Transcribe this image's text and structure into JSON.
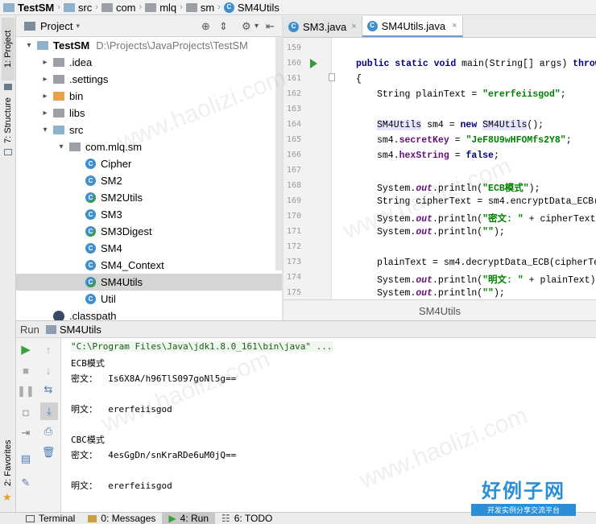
{
  "breadcrumbs": [
    "TestSM",
    "src",
    "com",
    "mlq",
    "sm",
    "SM4Utils"
  ],
  "sidebar": {
    "project_tab": "1: Project",
    "structure_tab": "7: Structure",
    "favorites_tab": "2: Favorites"
  },
  "project_panel": {
    "title": "Project",
    "tree": [
      {
        "label": "TestSM",
        "path": "D:\\Projects\\JavaProjects\\TestSM",
        "level": 0,
        "arrow": "▾",
        "icon": "folder-blue"
      },
      {
        "label": ".idea",
        "level": 1,
        "arrow": "▸",
        "icon": "folder-gray"
      },
      {
        "label": ".settings",
        "level": 1,
        "arrow": "▸",
        "icon": "folder-gray"
      },
      {
        "label": "bin",
        "level": 1,
        "arrow": "▸",
        "icon": "folder-orange"
      },
      {
        "label": "libs",
        "level": 1,
        "arrow": "▸",
        "icon": "folder-gray"
      },
      {
        "label": "src",
        "level": 1,
        "arrow": "▾",
        "icon": "folder-blue"
      },
      {
        "label": "com.mlq.sm",
        "level": 2,
        "arrow": "▾",
        "icon": "package"
      },
      {
        "label": "Cipher",
        "level": 3,
        "icon": "class"
      },
      {
        "label": "SM2",
        "level": 3,
        "icon": "class"
      },
      {
        "label": "SM2Utils",
        "level": 3,
        "icon": "class-main"
      },
      {
        "label": "SM3",
        "level": 3,
        "icon": "class"
      },
      {
        "label": "SM3Digest",
        "level": 3,
        "icon": "class-main"
      },
      {
        "label": "SM4",
        "level": 3,
        "icon": "class"
      },
      {
        "label": "SM4_Context",
        "level": 3,
        "icon": "class"
      },
      {
        "label": "SM4Utils",
        "level": 3,
        "icon": "class-main",
        "selected": true
      },
      {
        "label": "Util",
        "level": 3,
        "icon": "class"
      },
      {
        "label": ".classpath",
        "level": 1,
        "icon": "file"
      }
    ]
  },
  "editor": {
    "tabs": [
      {
        "label": "SM3.java",
        "active": false
      },
      {
        "label": "SM4Utils.java",
        "active": true
      }
    ],
    "line_numbers": [
      "159",
      "160",
      "161",
      "162",
      "163",
      "164",
      "165",
      "166",
      "167",
      "168",
      "169",
      "170",
      "171",
      "172",
      "173",
      "174",
      "175"
    ],
    "footer": "SM4Utils"
  },
  "run_panel": {
    "label": "Run",
    "config": "SM4Utils",
    "console_lines": [
      "\"C:\\Program Files\\Java\\jdk1.8.0_161\\bin\\java\" ...",
      "ECB模式",
      "密文：  Is6X8A/h96TlS097goNl5g==",
      "",
      "明文：  ererfeiisgod",
      "",
      "CBC模式",
      "密文：  4esGgDn/snKraRDe6uM0jQ==",
      "",
      "明文：  ererfeiisgod"
    ]
  },
  "statusbar": {
    "items": [
      {
        "label": "Terminal",
        "active": false
      },
      {
        "label": "0: Messages",
        "active": false
      },
      {
        "label": "4: Run",
        "active": true
      },
      {
        "label": "6: TODO",
        "active": false
      }
    ]
  },
  "watermark": {
    "text": "www.haolizi.com",
    "logo_title": "好例子网",
    "logo_subtitle": "开发实例分享交流平台"
  }
}
